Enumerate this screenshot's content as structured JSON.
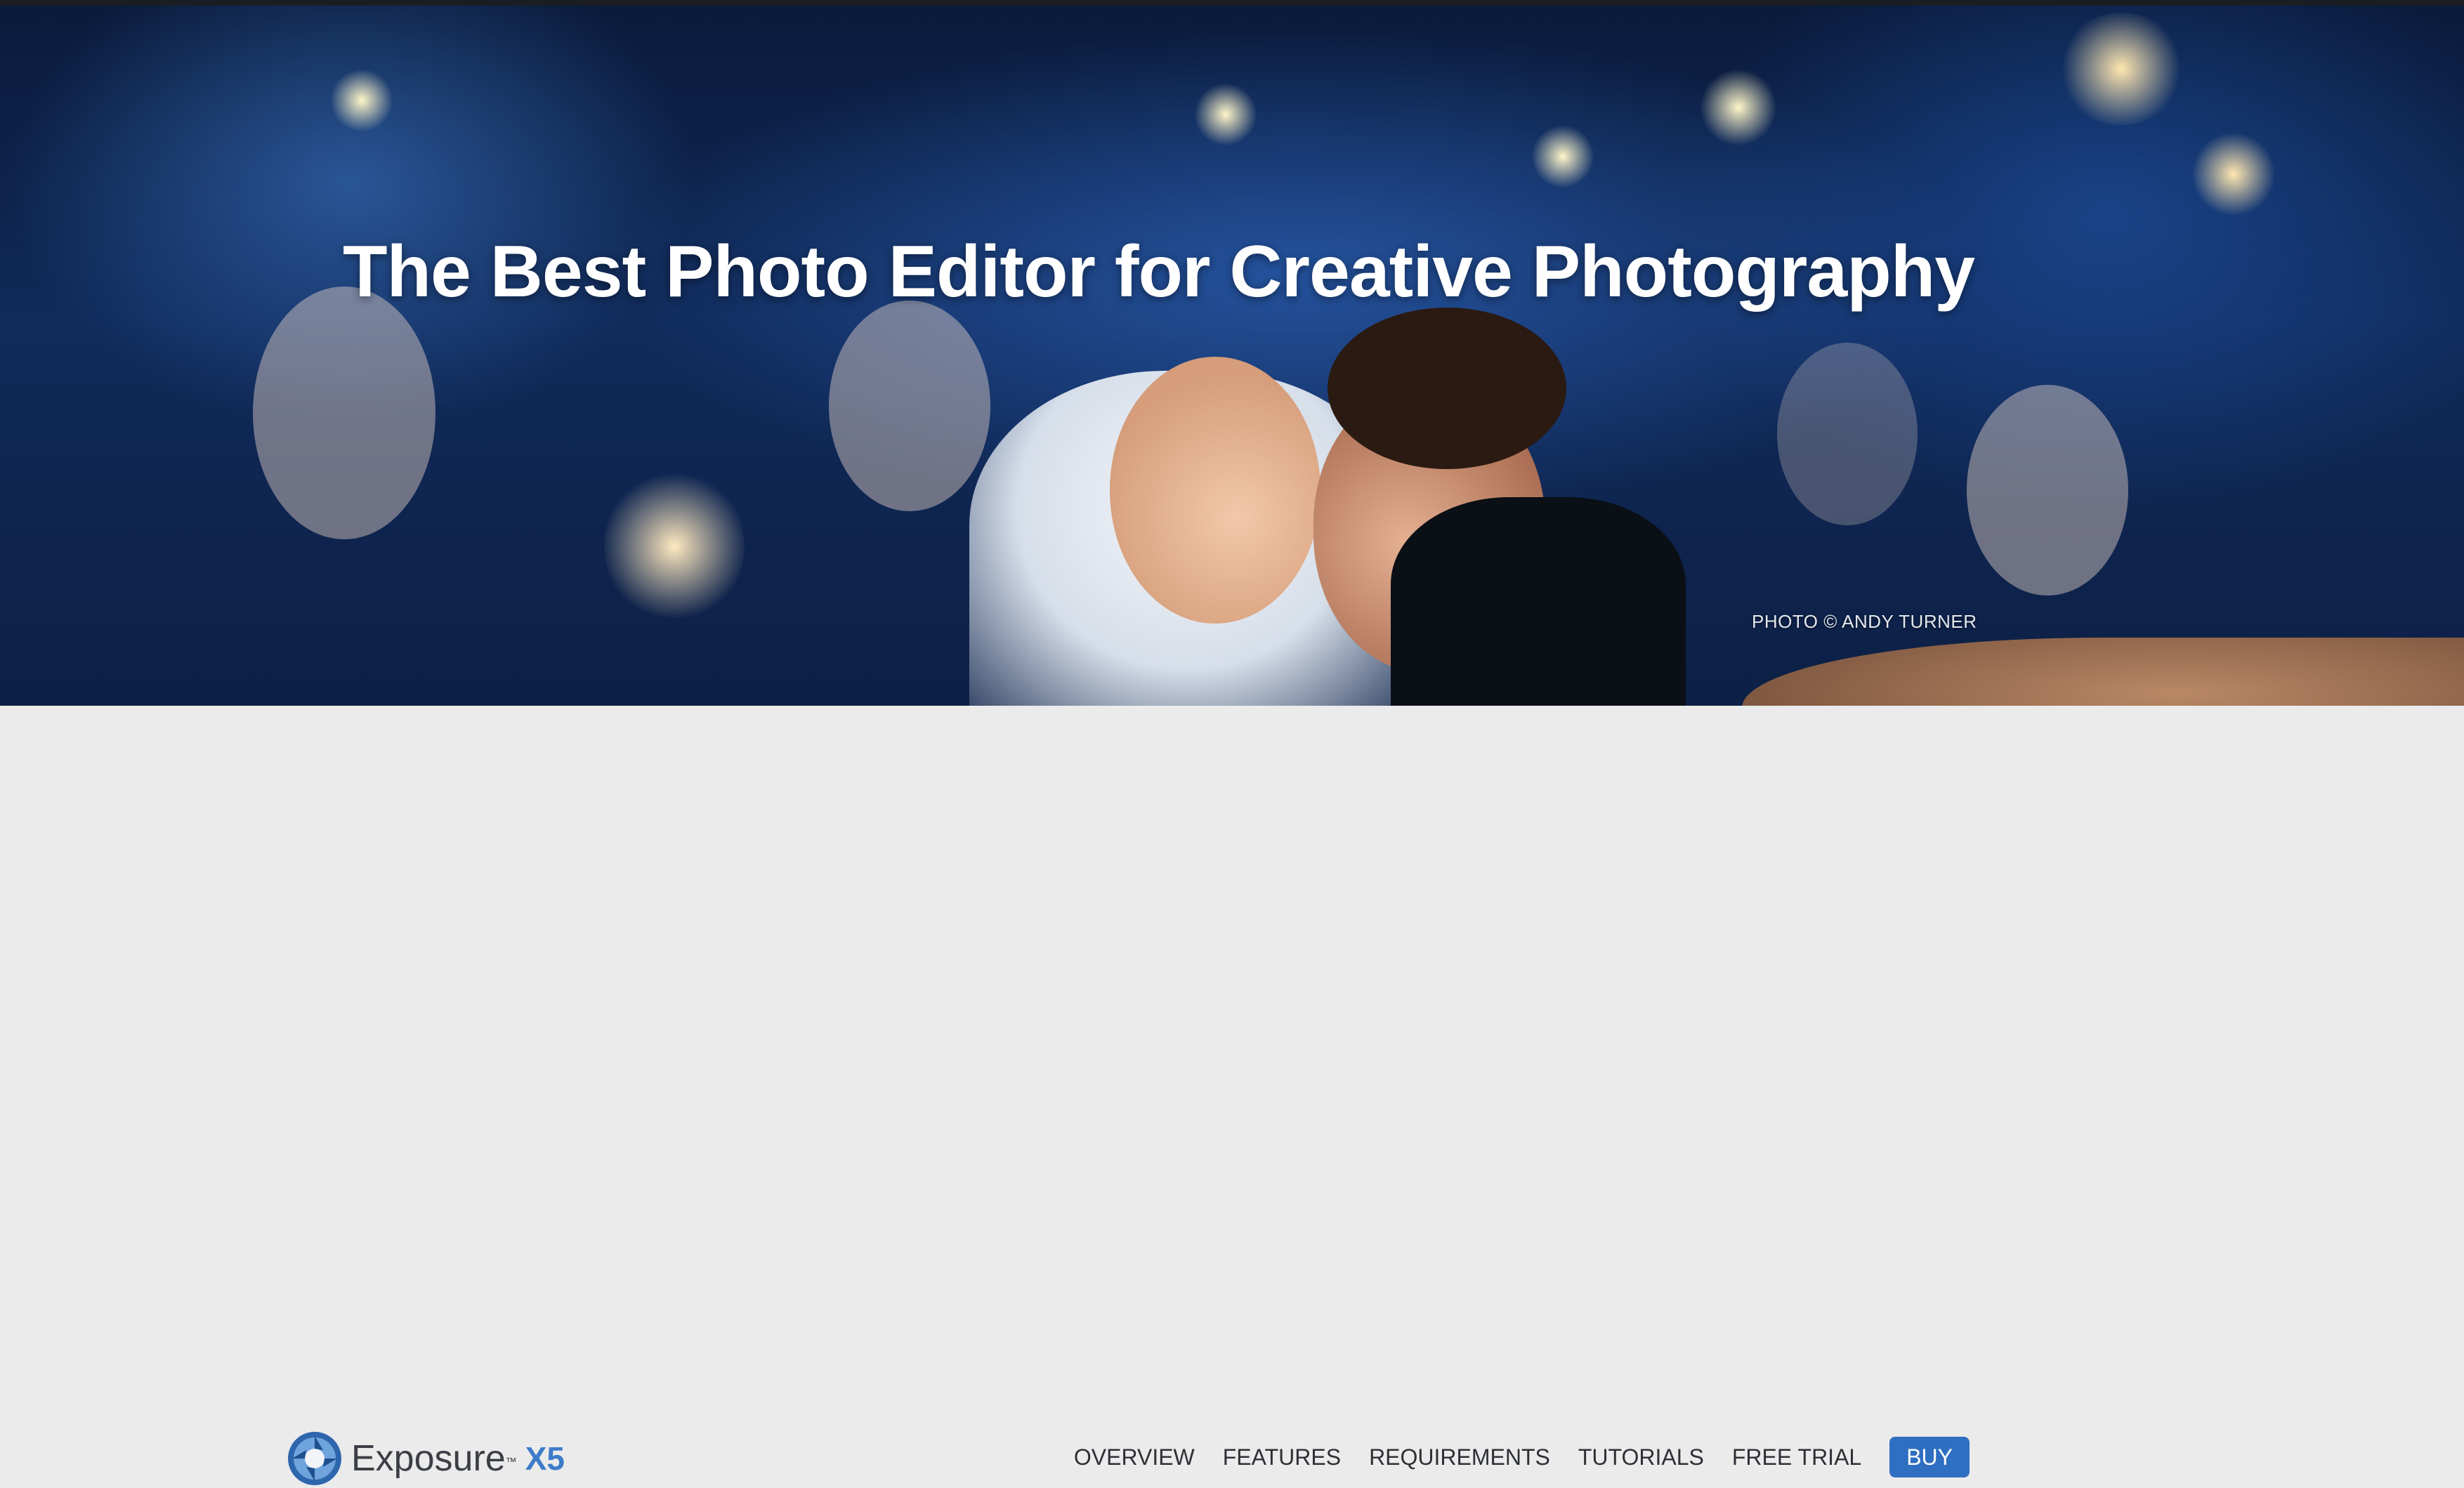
{
  "hero": {
    "title": "The Best Photo Editor for Creative Photography",
    "credit": "PHOTO © ANDY TURNER"
  },
  "nav": {
    "logo_name": "Exposure",
    "logo_tm": "™",
    "logo_version": "X5",
    "links": [
      "OVERVIEW",
      "FEATURES",
      "REQUIREMENTS",
      "TUTORIALS",
      "FREE TRIAL"
    ],
    "buy_label": "BUY"
  },
  "colors": {
    "accent": "#2f6fc2",
    "logo_version": "#3d7cc9",
    "nav_background": "#ebebeb",
    "nav_text": "#2d3035"
  }
}
